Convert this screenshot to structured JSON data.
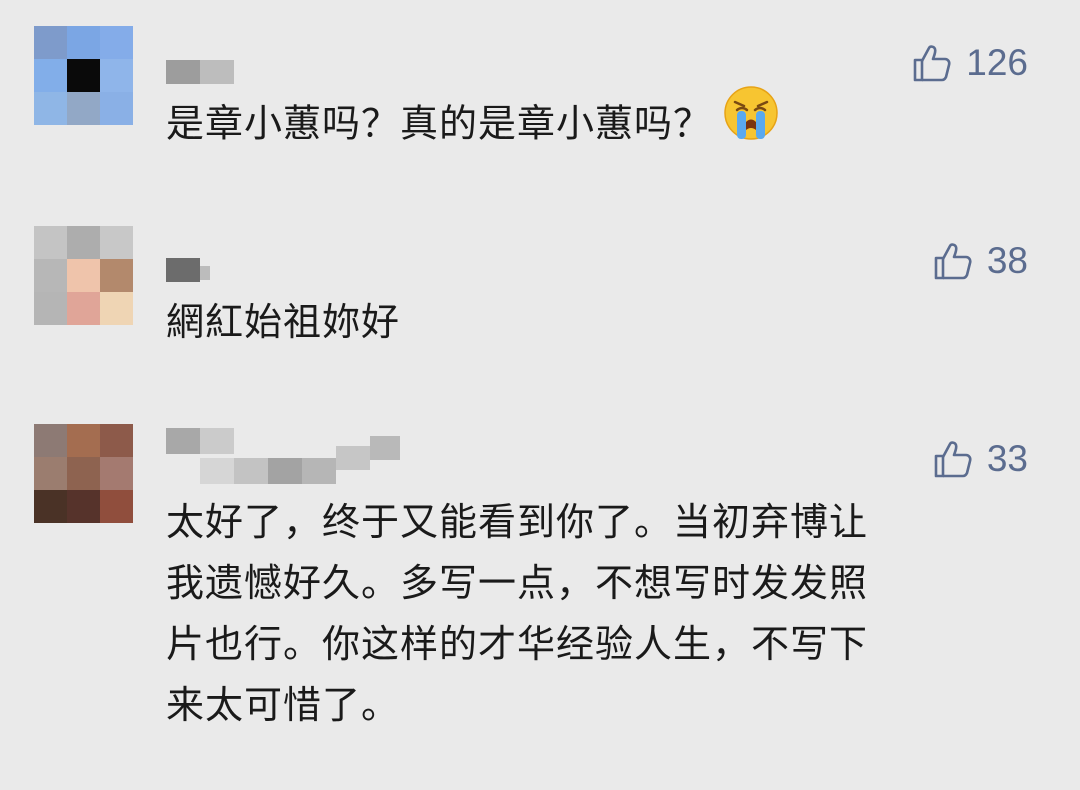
{
  "comments": [
    {
      "likes": "126",
      "lines": [
        "是章小蕙吗？真的是章小蕙吗？"
      ],
      "emoji": "crying-face-emoji"
    },
    {
      "likes": "38",
      "lines": [
        "網紅始祖妳好"
      ]
    },
    {
      "likes": "33",
      "lines": [
        "太好了，终于又能看到你了。当初弃博让",
        "我遗憾好久。多写一点，不想写时发发照",
        "片也行。你这样的才华经验人生，不写下",
        "来太可惜了。"
      ]
    }
  ],
  "icons": {
    "like": "thumbs-up-icon"
  },
  "colors": {
    "background": "#eaeaea",
    "text": "#1a1a1a",
    "like": "#5b6c8f"
  }
}
